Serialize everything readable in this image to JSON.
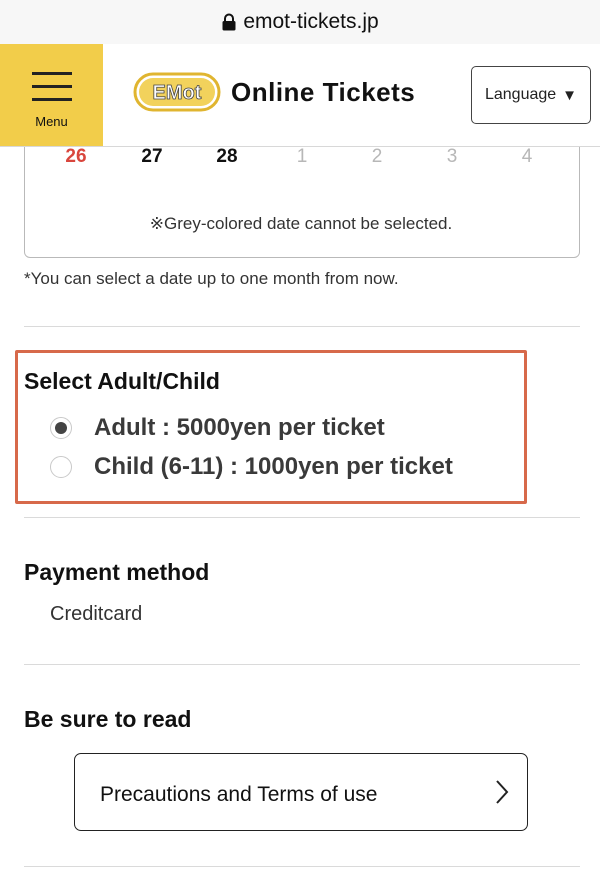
{
  "browser": {
    "url": "emot-tickets.jp"
  },
  "header": {
    "menu_label": "Menu",
    "logo_mark": "EMot",
    "brand": "Online Tickets",
    "language_label": "Language",
    "accent_color": "#f2cd4a"
  },
  "calendar": {
    "days": [
      {
        "label": "26",
        "state": "sunday"
      },
      {
        "label": "27",
        "state": "available"
      },
      {
        "label": "28",
        "state": "available"
      },
      {
        "label": "1",
        "state": "disabled"
      },
      {
        "label": "2",
        "state": "disabled"
      },
      {
        "label": "3",
        "state": "disabled"
      },
      {
        "label": "4",
        "state": "disabled"
      }
    ],
    "note": "※Grey-colored date cannot be selected.",
    "hint": "*You can select a date up to one month from now."
  },
  "ticket_type": {
    "title": "Select Adult/Child",
    "options": [
      {
        "label": "Adult : 5000yen per ticket",
        "selected": true
      },
      {
        "label": "Child (6-11) : 1000yen per ticket",
        "selected": false
      }
    ],
    "highlight_color": "#d7694a"
  },
  "payment": {
    "title": "Payment method",
    "value": "Creditcard"
  },
  "read": {
    "title": "Be sure to read",
    "button_label": "Precautions and Terms of use"
  }
}
